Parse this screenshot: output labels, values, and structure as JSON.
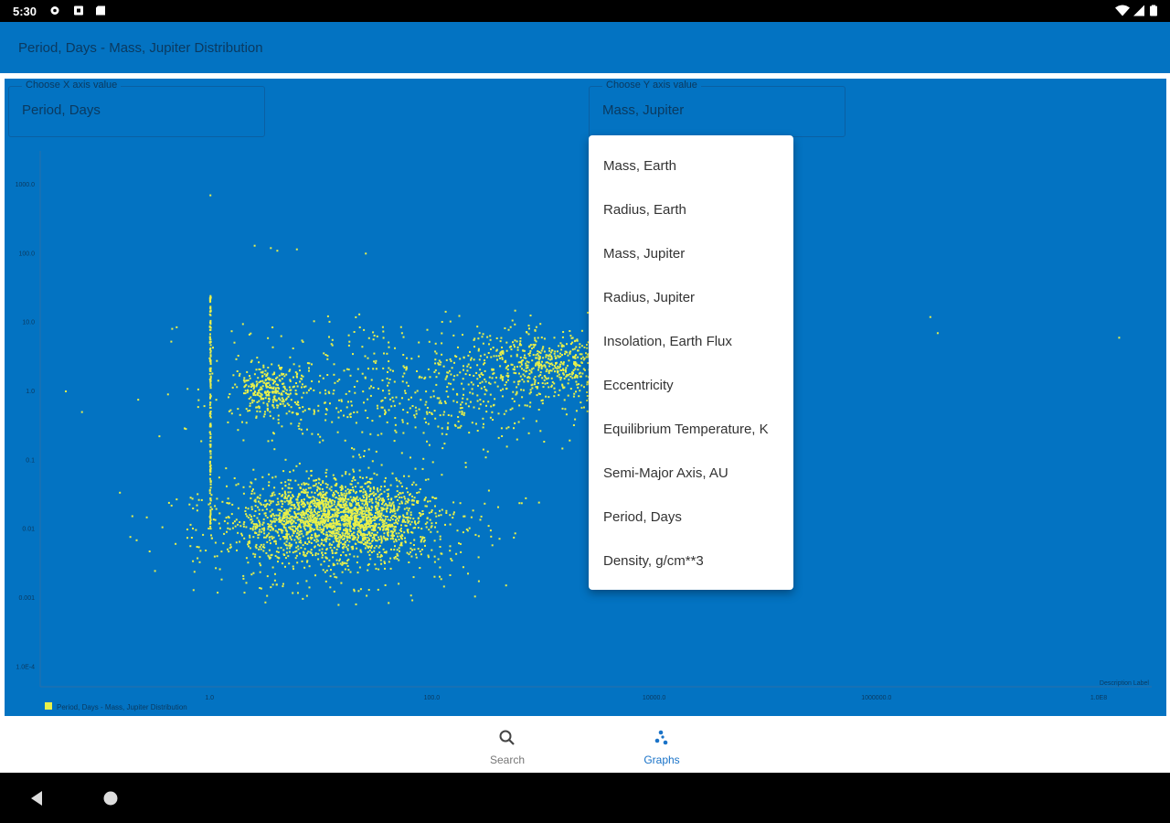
{
  "status_bar": {
    "time": "5:30"
  },
  "app_bar": {
    "title": "Period, Days - Mass, Jupiter Distribution"
  },
  "x_select": {
    "label": "Choose X axis value",
    "value": "Period, Days"
  },
  "y_select": {
    "label": "Choose Y axis value",
    "value": "Mass, Jupiter"
  },
  "dropdown": {
    "items": [
      "Mass, Earth",
      "Radius, Earth",
      "Mass, Jupiter",
      "Radius, Jupiter",
      "Insolation, Earth Flux",
      "Eccentricity",
      "Equilibrium Temperature, K",
      "Semi-Major Axis, AU",
      "Period, Days",
      "Density, g/cm**3"
    ]
  },
  "colors": {
    "background": "#0373c2",
    "points": "#e8f04a",
    "axis_text": "#0b3a60",
    "nav_active": "#1a73c8",
    "nav_inactive": "#777777"
  },
  "nav": {
    "search": {
      "label": "Search",
      "icon": "search-icon"
    },
    "graphs": {
      "label": "Graphs",
      "icon": "graphs-icon"
    }
  },
  "chart_data": {
    "type": "scatter",
    "x_scale": "log",
    "y_scale": "log",
    "x_tick_labels": [
      "1.0",
      "100.0",
      "10000.0",
      "1000000.0",
      "1.0E8"
    ],
    "y_tick_labels": [
      "1000.0",
      "100.0",
      "10.0",
      "1.0",
      "0.1",
      "0.01",
      "0.001",
      "1.0E-4"
    ],
    "xlim": [
      0.03,
      300000000
    ],
    "ylim": [
      5e-05,
      3000
    ],
    "description_label": "Description Label",
    "legend": {
      "label": "Period, Days - Mass, Jupiter Distribution",
      "position": "bottom-left"
    },
    "series": [
      {
        "name": "Period, Days - Mass, Jupiter Distribution",
        "clusters": [
          {
            "x_center": 15,
            "y_center": 0.015,
            "x_spread_decades": 0.55,
            "y_spread_decades": 0.35,
            "count": 1600
          },
          {
            "x_center": 12,
            "y_center": 0.01,
            "x_spread_decades": 0.9,
            "y_spread_decades": 0.6,
            "count": 900
          },
          {
            "x_center": 3.5,
            "y_center": 1.0,
            "x_spread_decades": 0.25,
            "y_spread_decades": 0.25,
            "count": 300
          },
          {
            "x_center": 1500,
            "y_center": 2.5,
            "x_spread_decades": 0.6,
            "y_spread_decades": 0.35,
            "count": 700
          },
          {
            "x_center": 60,
            "y_center": 1.0,
            "x_spread_decades": 1.2,
            "y_spread_decades": 0.7,
            "count": 600
          }
        ],
        "vertical_band": {
          "x": 1.0,
          "y_from": 0.01,
          "y_to": 25,
          "count": 160
        },
        "outliers": [
          {
            "x": 1.0,
            "y": 700
          },
          {
            "x": 2.5,
            "y": 130
          },
          {
            "x": 3.5,
            "y": 120
          },
          {
            "x": 4.0,
            "y": 110
          },
          {
            "x": 6.0,
            "y": 115
          },
          {
            "x": 25,
            "y": 100
          },
          {
            "x": 3000000,
            "y": 12
          },
          {
            "x": 3500000,
            "y": 7
          },
          {
            "x": 150000000,
            "y": 6
          },
          {
            "x": 0.05,
            "y": 1.0
          },
          {
            "x": 0.07,
            "y": 0.5
          },
          {
            "x": 20,
            "y": 4e-05
          }
        ]
      }
    ]
  }
}
